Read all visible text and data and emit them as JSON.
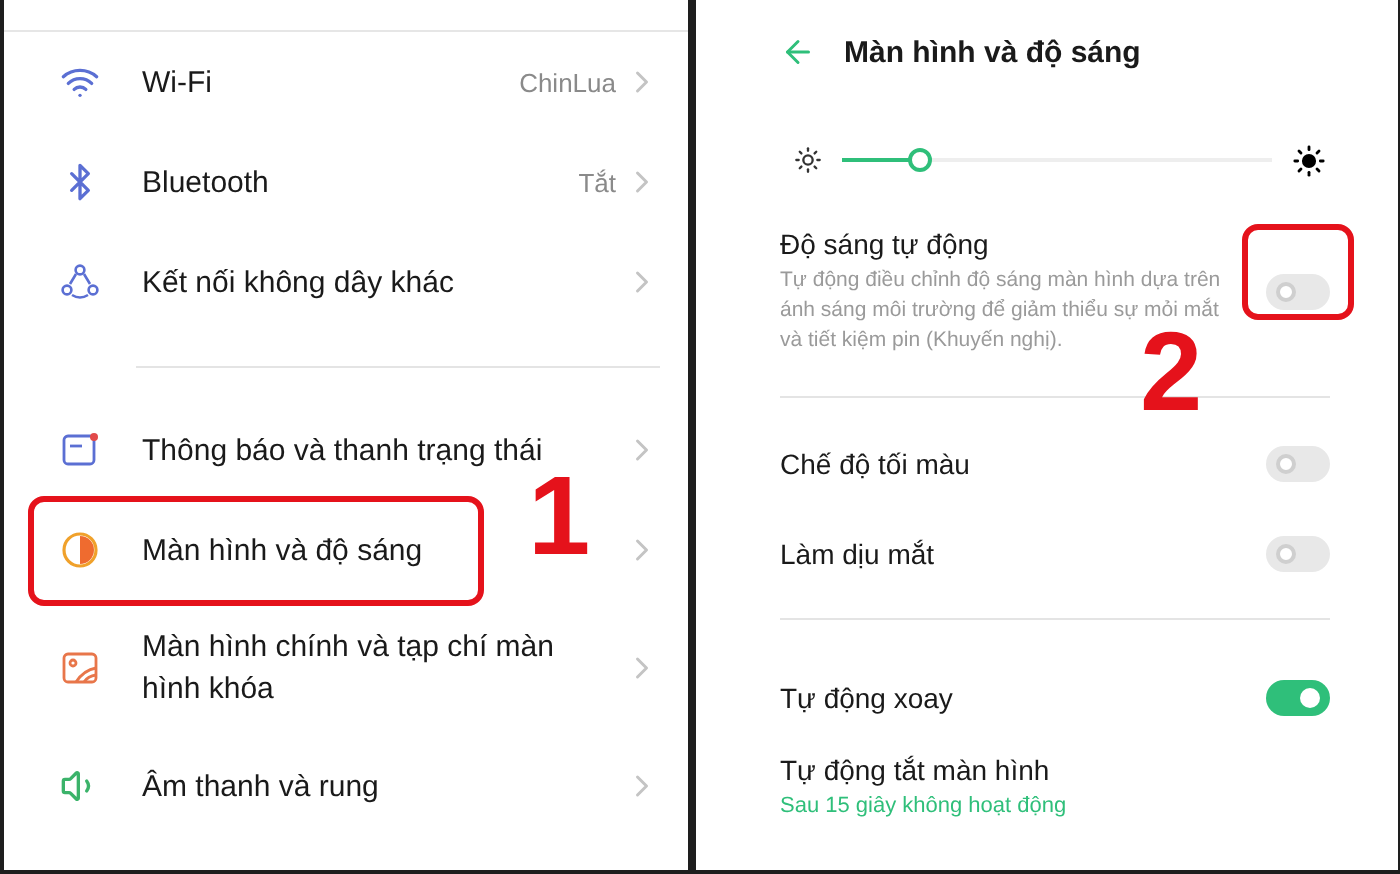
{
  "left_screen": {
    "groups": [
      {
        "items": [
          {
            "label": "Wi-Fi",
            "value": "ChinLua",
            "highlighted": false
          },
          {
            "label": "Bluetooth",
            "value": "Tắt",
            "highlighted": false
          },
          {
            "label": "Kết nối không dây khác",
            "highlighted": false
          }
        ]
      },
      {
        "items": [
          {
            "label": "Thông báo và thanh trạng thái",
            "highlighted": false
          },
          {
            "label": "Màn hình và độ sáng",
            "highlighted": true,
            "callout": "1"
          },
          {
            "label": "Màn hình chính và tạp chí màn hình khóa",
            "highlighted": false
          },
          {
            "label": "Âm thanh và rung",
            "highlighted": false
          }
        ]
      }
    ]
  },
  "right_screen": {
    "title": "Màn hình và độ sáng",
    "brightness": {
      "level": 0.18
    },
    "groups": [
      {
        "items": [
          {
            "kind": "toggle",
            "label": "Độ sáng tự động",
            "description": "Tự động điều chỉnh độ sáng màn hình dựa trên ánh sáng môi trường để giảm thiểu sự mỏi mắt và tiết kiệm pin (Khuyến nghị).",
            "on": false,
            "highlighted": true,
            "callout": "2"
          }
        ]
      },
      {
        "items": [
          {
            "kind": "toggle",
            "label": "Chế độ tối màu",
            "on": false,
            "highlighted": false
          },
          {
            "kind": "toggle",
            "label": "Làm dịu mắt",
            "on": false,
            "highlighted": false
          }
        ]
      },
      {
        "items": [
          {
            "kind": "toggle",
            "label": "Tự động xoay",
            "on": true,
            "highlighted": false
          },
          {
            "kind": "link",
            "label": "Tự động tắt màn hình",
            "description": "Sau 15 giây không hoạt động",
            "highlighted": false
          }
        ]
      }
    ]
  }
}
